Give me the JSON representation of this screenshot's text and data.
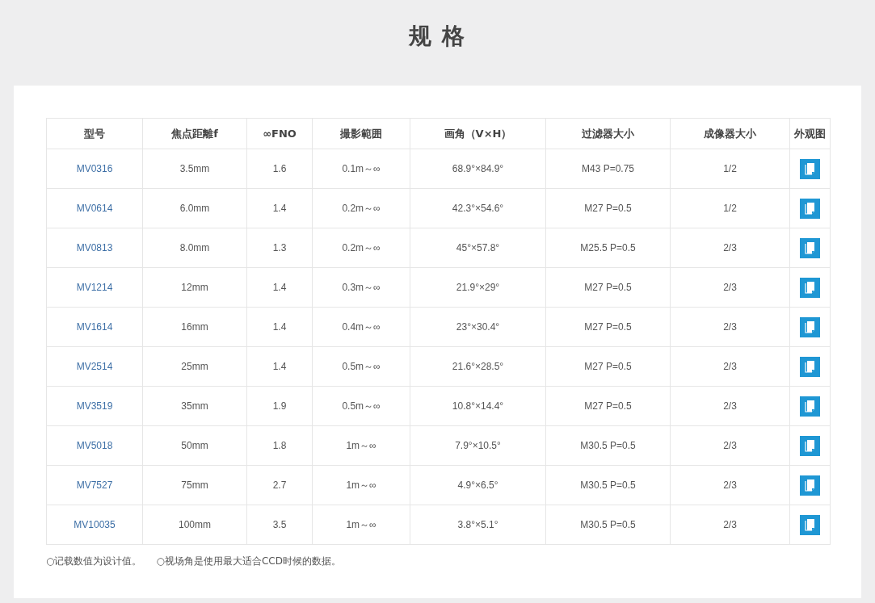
{
  "title": "规 格",
  "table": {
    "columns": [
      "型号",
      "焦点距離f",
      "∞FNO",
      "撮影範囲",
      "画角（V×H）",
      "过滤器大小",
      "成像器大小",
      "外观图"
    ],
    "rows": [
      [
        "MV0316",
        "3.5mm",
        "1.6",
        "0.1m～∞",
        "68.9°×84.9°",
        "M43 P=0.75",
        "1/2"
      ],
      [
        "MV0614",
        "6.0mm",
        "1.4",
        "0.2m～∞",
        "42.3°×54.6°",
        "M27 P=0.5",
        "1/2"
      ],
      [
        "MV0813",
        "8.0mm",
        "1.3",
        "0.2m～∞",
        "45°×57.8°",
        "M25.5 P=0.5",
        "2/3"
      ],
      [
        "MV1214",
        "12mm",
        "1.4",
        "0.3m～∞",
        "21.9°×29°",
        "M27 P=0.5",
        "2/3"
      ],
      [
        "MV1614",
        "16mm",
        "1.4",
        "0.4m～∞",
        "23°×30.4°",
        "M27 P=0.5",
        "2/3"
      ],
      [
        "MV2514",
        "25mm",
        "1.4",
        "0.5m～∞",
        "21.6°×28.5°",
        "M27 P=0.5",
        "2/3"
      ],
      [
        "MV3519",
        "35mm",
        "1.9",
        "0.5m～∞",
        "10.8°×14.4°",
        "M27 P=0.5",
        "2/3"
      ],
      [
        "MV5018",
        "50mm",
        "1.8",
        "1m～∞",
        "7.9°×10.5°",
        "M30.5 P=0.5",
        "2/3"
      ],
      [
        "MV7527",
        "75mm",
        "2.7",
        "1m～∞",
        "4.9°×6.5°",
        "M30.5 P=0.5",
        "2/3"
      ],
      [
        "MV10035",
        "100mm",
        "3.5",
        "1m～∞",
        "3.8°×5.1°",
        "M30.5 P=0.5",
        "2/3"
      ]
    ]
  },
  "notes": [
    "○记载数值为设计值。",
    "○视场角是使用最大适合CCD时候的数据。"
  ]
}
